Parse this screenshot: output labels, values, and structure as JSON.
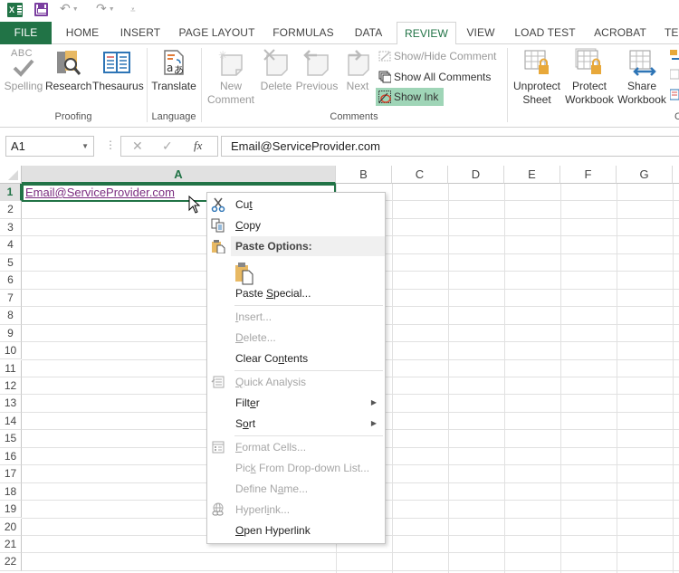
{
  "qat": {
    "app_icon": "excel-logo-icon",
    "app_icon_text": "X",
    "save_icon": "save-icon",
    "undo_icon": "undo-icon",
    "redo_icon": "redo-icon",
    "customize_icon": "customize-qat-icon"
  },
  "tabs": [
    {
      "label": "FILE",
      "state": "file"
    },
    {
      "label": "HOME",
      "state": "normal"
    },
    {
      "label": "INSERT",
      "state": "normal"
    },
    {
      "label": "PAGE LAYOUT",
      "state": "normal"
    },
    {
      "label": "FORMULAS",
      "state": "normal"
    },
    {
      "label": "DATA",
      "state": "normal"
    },
    {
      "label": "REVIEW",
      "state": "active"
    },
    {
      "label": "VIEW",
      "state": "normal"
    },
    {
      "label": "LOAD TEST",
      "state": "normal"
    },
    {
      "label": "ACROBAT",
      "state": "normal"
    },
    {
      "label": "TE",
      "state": "normal"
    }
  ],
  "ribbon": {
    "groups": {
      "proofing": "Proofing",
      "language": "Language",
      "comments": "Comments",
      "changes": "Chang"
    },
    "proofing": {
      "spelling": "Spelling",
      "spelling_icon_text": "ABC",
      "research": "Research",
      "thesaurus": "Thesaurus"
    },
    "language": {
      "translate": "Translate"
    },
    "comments": {
      "new_comment_1": "New",
      "new_comment_2": "Comment",
      "delete": "Delete",
      "previous": "Previous",
      "next": "Next",
      "show_hide": "Show/Hide Comment",
      "show_all": "Show All Comments",
      "show_ink": "Show Ink"
    },
    "changes": {
      "unprotect_1": "Unprotect",
      "unprotect_2": "Sheet",
      "protect_1": "Protect",
      "protect_2": "Workbook",
      "share_1": "Share",
      "share_2": "Workbook"
    }
  },
  "formula_bar": {
    "name_box": "A1",
    "cancel_icon": "✕",
    "enter_icon": "✓",
    "fx_label": "fx",
    "value": "Email@ServiceProvider.com"
  },
  "sheet": {
    "columns": [
      "A",
      "B",
      "C",
      "D",
      "E",
      "F",
      "G"
    ],
    "rows": [
      "1",
      "2",
      "3",
      "4",
      "5",
      "6",
      "7",
      "8",
      "9",
      "10",
      "11",
      "12",
      "13",
      "14",
      "15",
      "16",
      "17",
      "18",
      "19",
      "20",
      "21",
      "22"
    ],
    "active_cell": "A1",
    "a1_value": "Email@ServiceProvider.com"
  },
  "context_menu": {
    "items": [
      {
        "pre": "Cu",
        "u": "t",
        "post": "",
        "disabled": false,
        "icon": "scissors-icon"
      },
      {
        "pre": "",
        "u": "C",
        "post": "opy",
        "disabled": false,
        "icon": "copy-icon"
      },
      {
        "label": "Paste Options:",
        "header": true,
        "icon": "paste-icon"
      },
      {
        "pre": "Paste ",
        "u": "S",
        "post": "pecial...",
        "disabled": false
      },
      {
        "pre": "",
        "u": "I",
        "post": "nsert...",
        "disabled": true
      },
      {
        "pre": "",
        "u": "D",
        "post": "elete...",
        "disabled": true
      },
      {
        "pre": "Clear Co",
        "u": "n",
        "post": "tents",
        "disabled": false
      },
      {
        "pre": "",
        "u": "Q",
        "post": "uick Analysis",
        "disabled": true,
        "icon": "quick-analysis-icon"
      },
      {
        "pre": "Filt",
        "u": "e",
        "post": "r",
        "disabled": false,
        "submenu": true
      },
      {
        "pre": "S",
        "u": "o",
        "post": "rt",
        "disabled": false,
        "submenu": true
      },
      {
        "pre": "",
        "u": "F",
        "post": "ormat Cells...",
        "disabled": true,
        "icon": "format-cells-icon"
      },
      {
        "pre": "Pic",
        "u": "k",
        "post": " From Drop-down List...",
        "disabled": true
      },
      {
        "pre": "Define N",
        "u": "a",
        "post": "me...",
        "disabled": true
      },
      {
        "pre": "Hyperl",
        "u": "i",
        "post": "nk...",
        "disabled": true,
        "icon": "hyperlink-icon"
      },
      {
        "pre": "",
        "u": "O",
        "post": "pen Hyperlink",
        "disabled": false
      }
    ],
    "submenu_arrow": "▶"
  },
  "colors": {
    "excel_green": "#217346",
    "show_ink_highlight": "#9fd5b7",
    "hyperlink": "#7b2c80",
    "save_purple": "#7b3fa0"
  }
}
